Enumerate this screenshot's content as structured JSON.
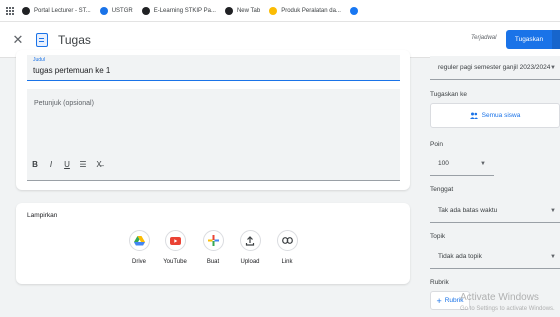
{
  "browser": {
    "bookmarks": [
      {
        "label": "Portal Lecturer - ST...",
        "color": "#202124"
      },
      {
        "label": "USTGR",
        "color": "#1a73e8"
      },
      {
        "label": "E-Learning STKIP Pa...",
        "color": "#202124"
      },
      {
        "label": "New Tab",
        "color": "#202124"
      },
      {
        "label": "Produk Peralatan da...",
        "color": "#fbbc04"
      },
      {
        "label": "",
        "color": "#1877f2"
      }
    ]
  },
  "header": {
    "title": "Tugas",
    "assigned_label": "Terjadwal",
    "assign_button": "Tugaskan"
  },
  "form": {
    "title_label": "Judul",
    "title_value": "tugas pertemuan ke 1",
    "instructions_placeholder": "Petunjuk (opsional)",
    "format_tools": [
      "B",
      "I",
      "U",
      "☰",
      "X̶"
    ]
  },
  "attachments": {
    "heading": "Lampirkan",
    "items": [
      {
        "label": "Drive",
        "icon": "drive-icon"
      },
      {
        "label": "YouTube",
        "icon": "youtube-icon"
      },
      {
        "label": "Buat",
        "icon": "create-plus-icon"
      },
      {
        "label": "Upload",
        "icon": "upload-icon"
      },
      {
        "label": "Link",
        "icon": "link-icon"
      }
    ]
  },
  "sidebar": {
    "class_value": "reguler pagi semester ganjil 2023/2024",
    "assign_to_label": "Tugaskan ke",
    "students_value": "Semua siswa",
    "points_label": "Poin",
    "points_value": "100",
    "due_label": "Tenggat",
    "due_value": "Tak ada batas waktu",
    "topic_label": "Topik",
    "topic_value": "Tidak ada topik",
    "rubric_label": "Rubrik",
    "rubric_button": "Rubrik"
  },
  "watermark": {
    "title": "Activate Windows",
    "subtitle": "Go to Settings to activate Windows."
  },
  "colors": {
    "accent": "#1a73e8"
  }
}
